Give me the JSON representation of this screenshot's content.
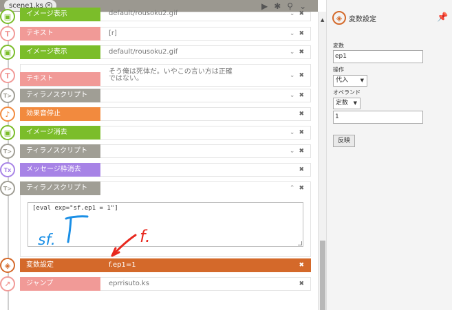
{
  "tab": {
    "label": "scene1.ks",
    "close": "⊗"
  },
  "toolbar": {
    "play": "▶",
    "debug": "✱",
    "search": "⚲",
    "menu": "⌄"
  },
  "rows": [
    {
      "tag": "イメージ表示",
      "value": "default/rousoku2.gif",
      "color": "#7bbd2a",
      "icon": "image-icon",
      "glyph": "▣"
    },
    {
      "tag": "テキスト",
      "value": "[r]",
      "color": "#f19a97",
      "icon": "text-icon",
      "glyph": "T"
    },
    {
      "tag": "イメージ表示",
      "value": "default/rousoku2.gif",
      "color": "#7bbd2a",
      "icon": "image-icon",
      "glyph": "▣"
    },
    {
      "tag": "テキスト",
      "value1": "そう俺は死体だ。いやこの言い方は正確",
      "value2": "ではない。",
      "color": "#f19a97",
      "icon": "text-icon",
      "glyph": "T"
    },
    {
      "tag": "ティラノスクリプト",
      "value": "",
      "color": "#a09e95",
      "icon": "tyrano-script-icon",
      "glyph": "T>"
    },
    {
      "tag": "効果音停止",
      "value": "",
      "color": "#f28a3e",
      "icon": "sound-stop-icon",
      "glyph": "♪"
    },
    {
      "tag": "イメージ消去",
      "value": "",
      "color": "#7bbd2a",
      "icon": "image-remove-icon",
      "glyph": "▣"
    },
    {
      "tag": "ティラノスクリプト",
      "value": "",
      "color": "#a09e95",
      "icon": "tyrano-script-icon",
      "glyph": "T>"
    },
    {
      "tag": "メッセージ枠消去",
      "value": "",
      "color": "#a783e6",
      "icon": "message-clear-icon",
      "glyph": "Tx"
    },
    {
      "tag": "ティラノスクリプト",
      "value": "",
      "color": "#a09e95",
      "icon": "tyrano-script-icon",
      "glyph": "T>"
    },
    {
      "tag": "変数設定",
      "value": "f.ep1=1",
      "color": "#d4692a",
      "icon": "variable-icon",
      "glyph": "◈"
    },
    {
      "tag": "ジャンプ",
      "value": "eprrisuto.ks",
      "color": "#f19a97",
      "icon": "jump-icon",
      "glyph": "↗"
    }
  ],
  "eval_code": "[eval exp=\"sf.ep1 = 1\"]",
  "controls": {
    "expand": "⌄",
    "collapse": "⌃",
    "close": "✖"
  },
  "annotations": {
    "sf": "sf.",
    "f": "f."
  },
  "panel": {
    "title": "変数設定",
    "variable_label": "変数",
    "variable_value": "ep1",
    "operation_label": "操作",
    "operation_value": "代入",
    "operand_label": "オペランド",
    "operand_type": "定数",
    "operand_value": "1",
    "apply_label": "反映"
  }
}
